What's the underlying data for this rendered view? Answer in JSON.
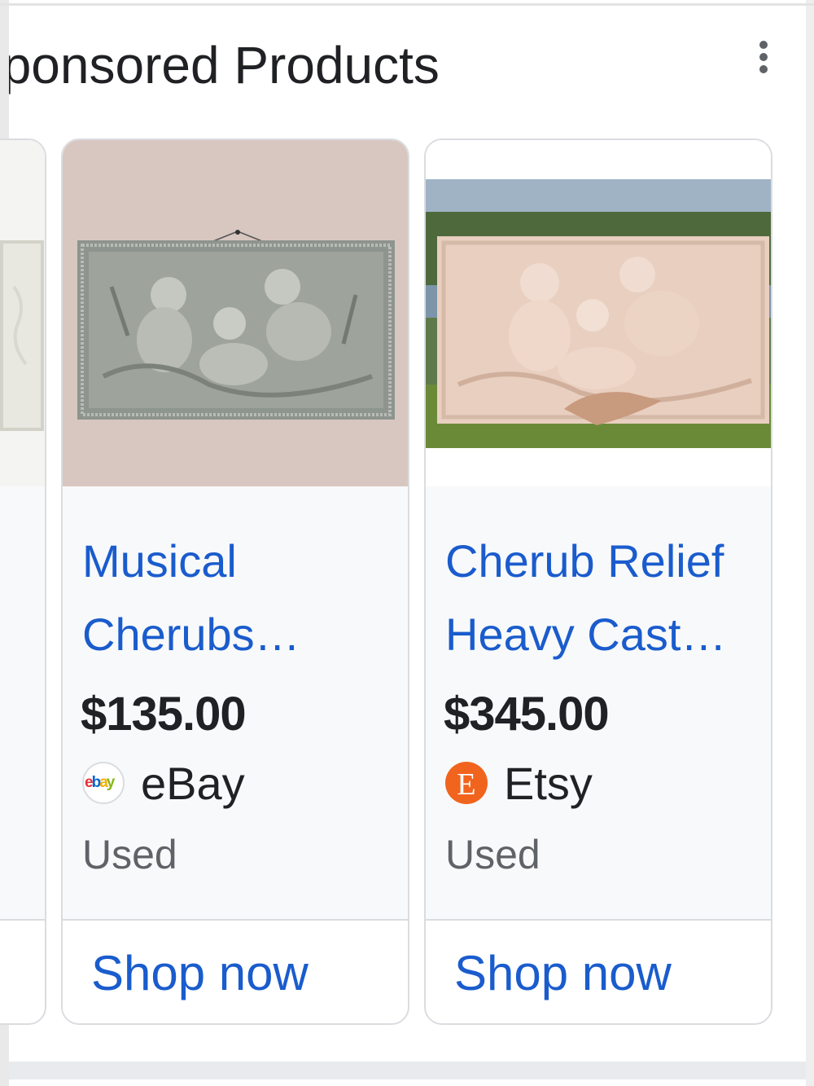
{
  "header": {
    "title": "Sponsored Products",
    "more_icon": "more-vert-icon"
  },
  "products": [
    {
      "title": "Musical Cherubs…",
      "price": "$135.00",
      "merchant": "eBay",
      "merchant_logo": "ebay",
      "condition": "Used",
      "cta": "Shop now"
    },
    {
      "title": "Cherub Relief Heavy Cast…",
      "price": "$345.00",
      "merchant": "Etsy",
      "merchant_logo": "E",
      "condition": "Used",
      "cta": "Shop now"
    }
  ],
  "colors": {
    "link": "#1a5ccd",
    "text": "#202124",
    "secondary": "#5f6368",
    "etsy": "#f1641e"
  }
}
